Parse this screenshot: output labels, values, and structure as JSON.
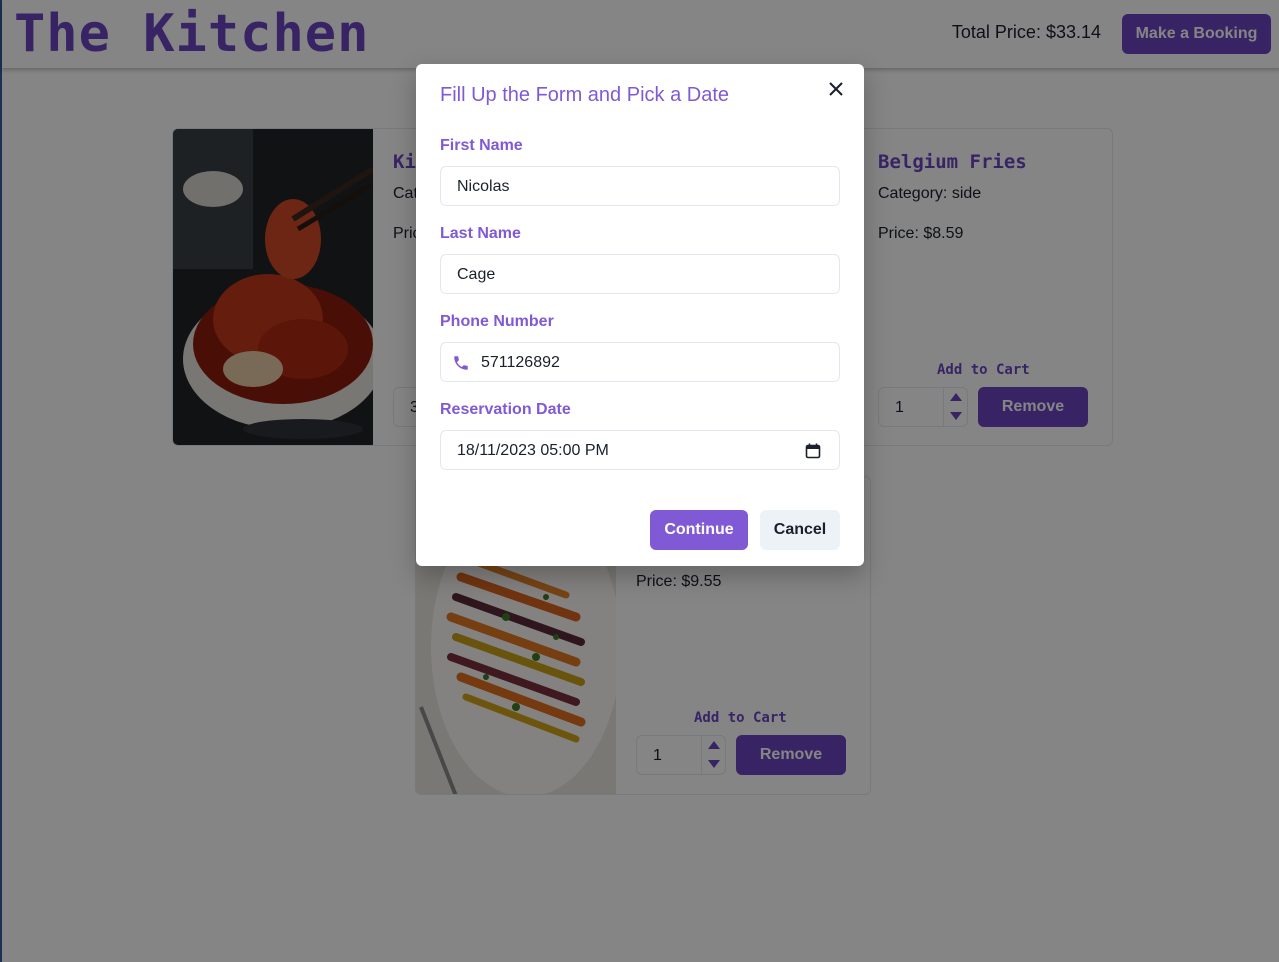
{
  "header": {
    "brand": "The Kitchen",
    "total_price": "Total Price: $33.14",
    "booking_button": "Make a Booking"
  },
  "cards": [
    {
      "name": "Ki",
      "category": "Cate",
      "price": "Pric",
      "quantity": "3",
      "image": "kimchi-photo"
    },
    {
      "name": "Belgium Fries",
      "category": "Category: side",
      "price": "Price: $8.59",
      "add_to_cart": "Add to Cart",
      "quantity": "1",
      "remove": "Remove"
    },
    {
      "price": "Price: $9.55",
      "add_to_cart": "Add to Cart",
      "quantity": "1",
      "remove": "Remove",
      "image": "roasted-carrots-photo"
    }
  ],
  "modal": {
    "title": "Fill Up the Form and Pick a Date",
    "first_name_label": "First Name",
    "first_name_value": "Nicolas",
    "last_name_label": "Last Name",
    "last_name_value": "Cage",
    "phone_label": "Phone Number",
    "phone_value": "571126892",
    "date_label": "Reservation Date",
    "date_value": "18/11/2023 05:00 PM",
    "continue": "Continue",
    "cancel": "Cancel"
  },
  "colors": {
    "accent": "#805ad5",
    "accent_dark": "#6b46c1",
    "overlay": "rgba(0,0,0,0.48)"
  },
  "icons": {
    "close": "close-icon",
    "phone": "phone-icon",
    "calendar": "calendar-icon"
  }
}
